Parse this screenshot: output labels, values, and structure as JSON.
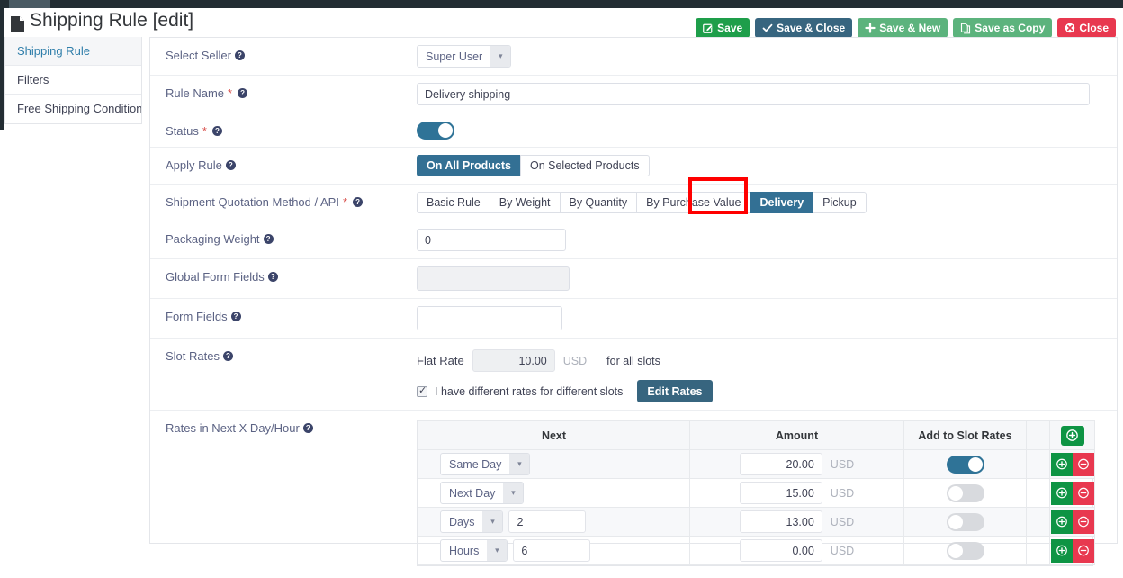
{
  "page": {
    "title": "Shipping Rule [edit]",
    "title_icon": "file-icon"
  },
  "toolbar": {
    "buttons": [
      {
        "label": "Save",
        "icon": "pencil-square-icon",
        "color": "#1e9e4a"
      },
      {
        "label": "Save & Close",
        "icon": "check-icon",
        "color": "#37657f"
      },
      {
        "label": "Save & New",
        "icon": "plus-icon",
        "color": "#5cb37d"
      },
      {
        "label": "Save as Copy",
        "icon": "copy-icon",
        "color": "#5cb37d"
      },
      {
        "label": "Close",
        "icon": "close-circle-icon",
        "color": "#e8384f"
      }
    ]
  },
  "sidebar": {
    "items": [
      {
        "label": "Shipping Rule",
        "active": true
      },
      {
        "label": "Filters",
        "active": false
      },
      {
        "label": "Free Shipping Conditions",
        "active": false
      }
    ]
  },
  "form": {
    "select_seller": {
      "label": "Select Seller",
      "value": "Super User",
      "required": false
    },
    "rule_name": {
      "label": "Rule Name",
      "value": "Delivery shipping",
      "required": true
    },
    "status": {
      "label": "Status",
      "value": "on",
      "required": true
    },
    "apply_rule": {
      "label": "Apply Rule",
      "required": false,
      "options": [
        "On All Products",
        "On Selected Products"
      ],
      "selected": "On All Products"
    },
    "quotation_method": {
      "label": "Shipment Quotation Method / API",
      "required": true,
      "options": [
        "Basic Rule",
        "By Weight",
        "By Quantity",
        "By Purchase Value",
        "Delivery",
        "Pickup"
      ],
      "selected": "Delivery",
      "highlighted": "Delivery"
    },
    "packaging_weight": {
      "label": "Packaging Weight",
      "value": "0",
      "required": false
    },
    "global_form_fields": {
      "label": "Global Form Fields",
      "value": "",
      "disabled": true
    },
    "form_fields": {
      "label": "Form Fields",
      "value": ""
    },
    "slot_rates": {
      "label": "Slot Rates",
      "flat_rate_label": "Flat Rate",
      "flat_rate_value": "10.00",
      "currency": "USD",
      "for_all_slots": "for all slots",
      "checkbox_checked": true,
      "checkbox_label": "I have different rates for different slots",
      "edit_rates_label": "Edit Rates"
    },
    "rates_next": {
      "label": "Rates in Next X Day/Hour"
    }
  },
  "rates_table": {
    "headers": [
      "Next",
      "Amount",
      "Add to Slot Rates",
      ""
    ],
    "add_row_icon": "plus-circle-icon",
    "currency": "USD",
    "rows": [
      {
        "next": "Same Day",
        "qty": "",
        "show_qty": false,
        "amount": "20.00",
        "slot_on": true
      },
      {
        "next": "Next Day",
        "qty": "",
        "show_qty": false,
        "amount": "15.00",
        "slot_on": false
      },
      {
        "next": "Days",
        "qty": "2",
        "show_qty": true,
        "amount": "13.00",
        "slot_on": false
      },
      {
        "next": "Hours",
        "qty": "6",
        "show_qty": true,
        "amount": "0.00",
        "slot_on": false
      }
    ],
    "row_add_icon": "plus-circle-icon",
    "row_remove_icon": "minus-circle-icon"
  },
  "colors": {
    "accent_teal": "#337094",
    "green": "#1e9e4a",
    "red": "#e8384f",
    "highlight": "#ff0000",
    "navbar": "#232d33"
  }
}
